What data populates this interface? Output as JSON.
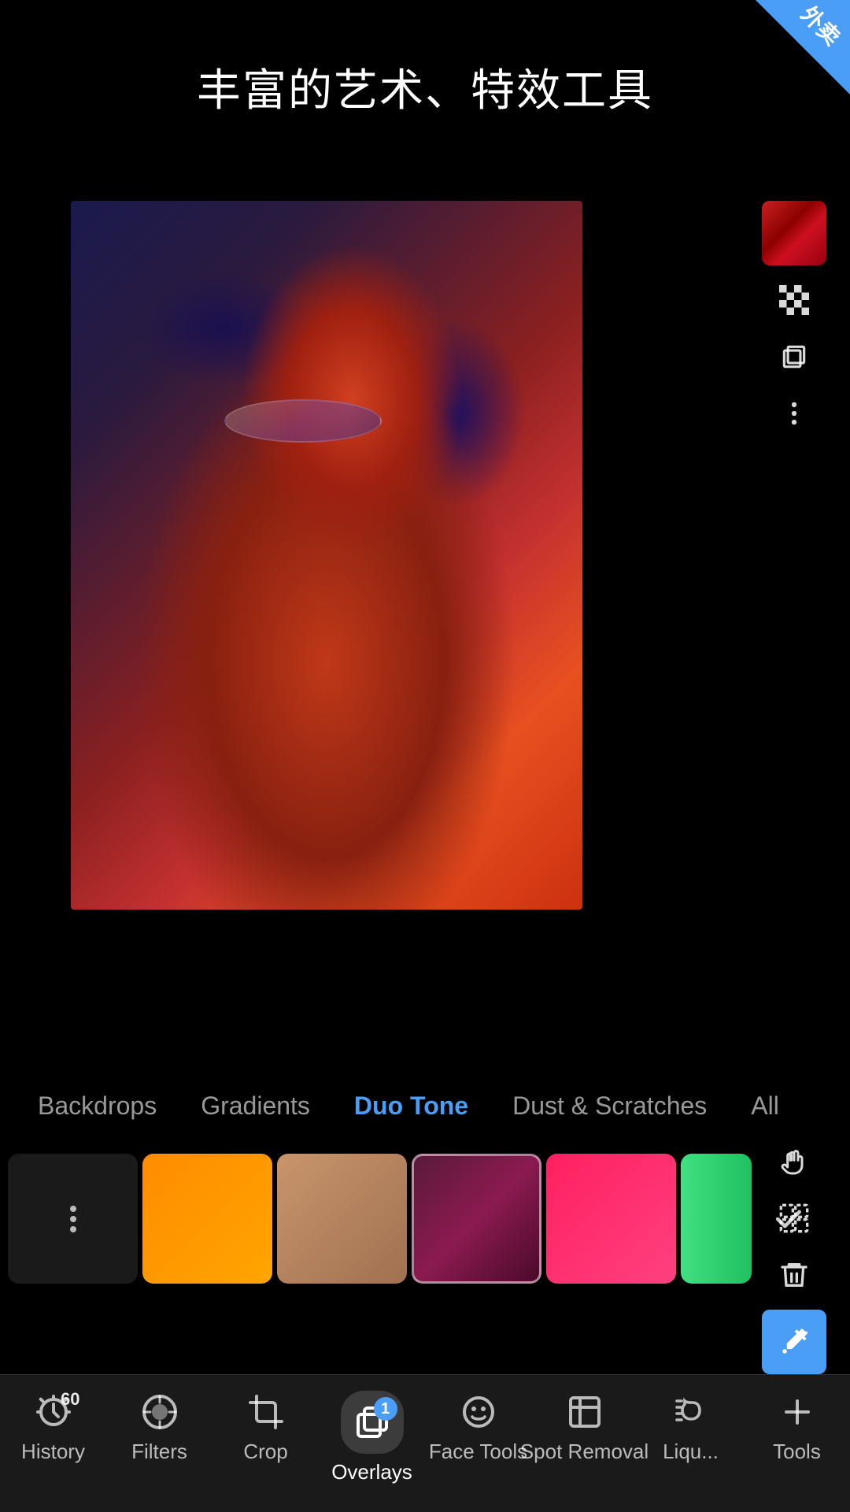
{
  "corner_badge": {
    "text": "外卖"
  },
  "header": {
    "title": "丰富的艺术、特效工具"
  },
  "right_toolbar": {
    "color_btn_label": "color-picker",
    "checker_label": "checkerboard",
    "layers_label": "layers",
    "more_label": "more-options",
    "hand_label": "pan-tool",
    "select_label": "selection-tool",
    "delete_label": "delete",
    "eyedropper_label": "eyedropper"
  },
  "category_tabs": [
    {
      "id": "backdrops",
      "label": "Backdrops",
      "active": false
    },
    {
      "id": "gradients",
      "label": "Gradients",
      "active": false
    },
    {
      "id": "duo-tone",
      "label": "Duo Tone",
      "active": true
    },
    {
      "id": "dust-scratches",
      "label": "Dust & Scratches",
      "active": false
    },
    {
      "id": "all",
      "label": "All",
      "active": false
    }
  ],
  "bottom_nav": [
    {
      "id": "history",
      "label": "History",
      "count": "60",
      "active": false
    },
    {
      "id": "filters",
      "label": "Filters",
      "active": false
    },
    {
      "id": "crop",
      "label": "Crop",
      "active": false
    },
    {
      "id": "overlays",
      "label": "Overlays",
      "badge": "1",
      "active": true
    },
    {
      "id": "face-tools",
      "label": "Face Tools",
      "active": false
    },
    {
      "id": "spot-removal",
      "label": "Spot Removal",
      "active": false
    },
    {
      "id": "liquify",
      "label": "Liqu...",
      "active": false
    },
    {
      "id": "tools",
      "label": "Tools",
      "active": false
    }
  ]
}
